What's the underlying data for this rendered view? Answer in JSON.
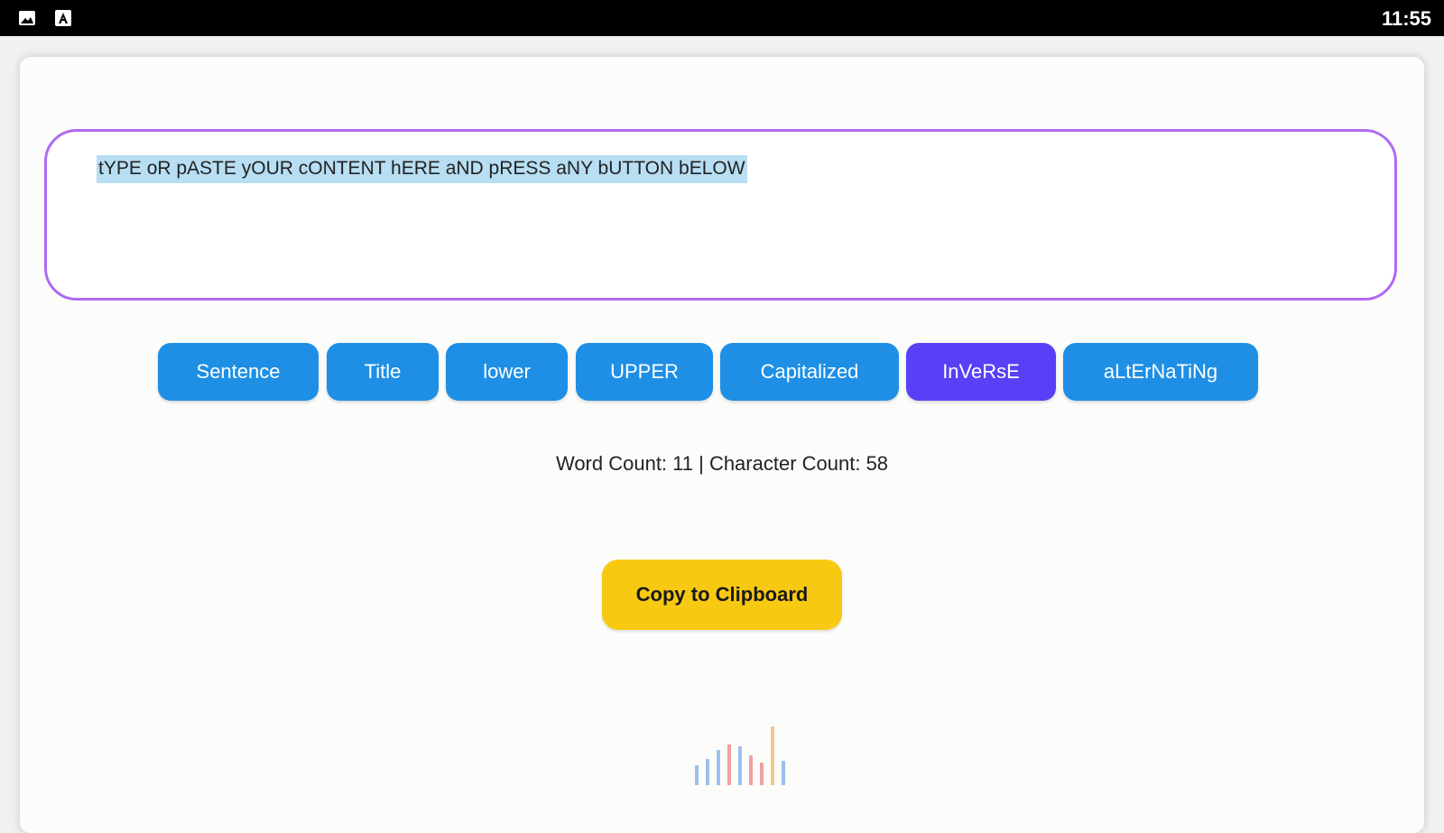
{
  "status_bar": {
    "time": "11:55",
    "icons": [
      "image-icon",
      "keyboard-a-icon"
    ]
  },
  "editor": {
    "text": "tYPE oR pASTE yOUR cONTENT hERE aND pRESS aNY bUTTON bELOW",
    "border_color": "#b06af2",
    "selection_color": "#b7def3"
  },
  "case_buttons": [
    {
      "label": "Sentence"
    },
    {
      "label": "Title"
    },
    {
      "label": "lower"
    },
    {
      "label": "UPPER"
    },
    {
      "label": "Capitalized"
    },
    {
      "label": "InVeRsE",
      "active": true
    },
    {
      "label": "aLtErNaTiNg"
    }
  ],
  "colors": {
    "button": "#1e8fe5",
    "button_active": "#5740f5",
    "copy_button": "#f7c912"
  },
  "stats": {
    "text": "Word Count: 11 | Character Count: 58"
  },
  "copy_button": {
    "label": "Copy to Clipboard"
  },
  "logo": {
    "icon": "audio-bars-logo",
    "bar_colors": [
      "#9cc0ec",
      "#f2a0a0",
      "#f7c48a"
    ]
  }
}
